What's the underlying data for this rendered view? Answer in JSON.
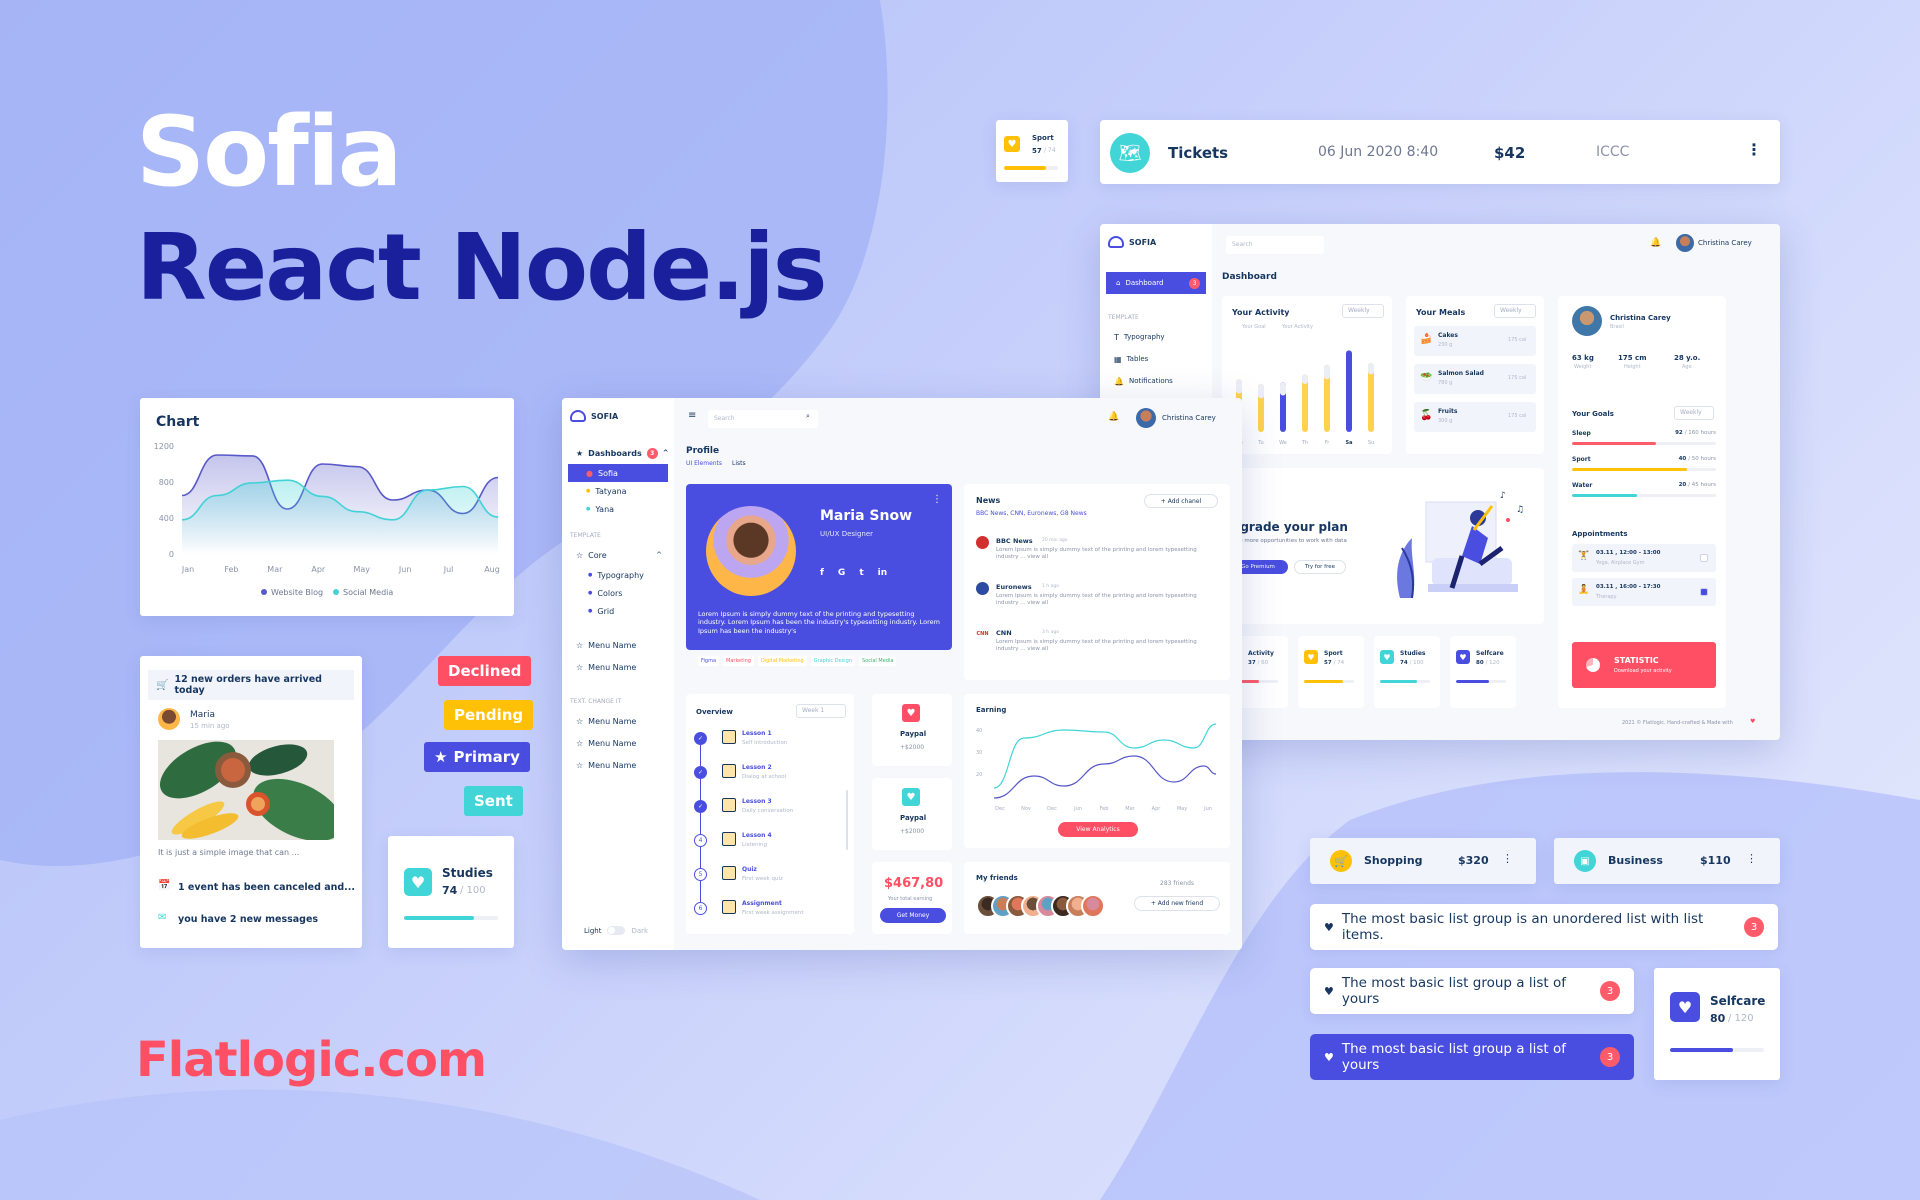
{
  "hero": {
    "line1": "Sofia",
    "line2": "React Node.js",
    "footer": "Flatlogic.com"
  },
  "colors": {
    "primary": "#4a4ee0",
    "navy": "#1a1f9b",
    "coral": "#ff4f64",
    "teal": "#41d5d8",
    "yellow": "#ffc107"
  },
  "sport_mini": {
    "label": "Sport",
    "value": "57",
    "total": "/ 74",
    "progress": 0.77
  },
  "tickets": {
    "icon": "map-icon",
    "title": "Tickets",
    "date": "06 Jun 2020 8:40",
    "price": "$42",
    "org": "ICCC"
  },
  "chart": {
    "title": "Chart"
  },
  "chart_data": {
    "type": "area",
    "categories": [
      "Jan",
      "Feb",
      "Mar",
      "Apr",
      "May",
      "Jun",
      "Jul",
      "Aug"
    ],
    "ylim": [
      0,
      1200
    ],
    "yticks": [
      "0",
      "400",
      "800",
      "1200"
    ],
    "series": [
      {
        "name": "Website Blog",
        "color": "#5758c9",
        "values": [
          650,
          1100,
          1090,
          500,
          1000,
          970,
          600,
          710,
          450,
          850
        ]
      },
      {
        "name": "Social Media",
        "color": "#42d2d6",
        "values": [
          380,
          650,
          790,
          820,
          640,
          470,
          380,
          710,
          750,
          410
        ]
      }
    ]
  },
  "notifications": {
    "items": [
      {
        "icon": "cart-icon",
        "text": "12 new orders have arrived today"
      },
      {
        "icon": "calendar-icon",
        "text": "1 event has been canceled and..."
      },
      {
        "icon": "envelope-icon",
        "text": "you have 2 new messages"
      }
    ],
    "post": {
      "name": "Maria",
      "time": "15 min ago",
      "caption": "It is just a simple image that can ..."
    }
  },
  "badges": {
    "declined": "Declined",
    "pending": "Pending",
    "primary": "Primary",
    "sent": "Sent"
  },
  "studies_card": {
    "label": "Studies",
    "value": "74",
    "total": "/ 100",
    "progress": 0.74
  },
  "selfcare_card": {
    "label": "Selfcare",
    "value": "80",
    "total": "/ 120",
    "progress": 0.67
  },
  "shopping": {
    "label": "Shopping",
    "amount": "$320"
  },
  "business": {
    "label": "Business",
    "amount": "$110"
  },
  "list_group": [
    "The most basic list group is an unordered list with list items.",
    "The most basic list group a list of yours",
    "The most basic list group a list of yours"
  ],
  "list_badge": "3",
  "profile_win": {
    "brand": "SOFIA",
    "search": "Search",
    "user": "Christina Carey",
    "nav": {
      "dashboards": "Dashboards",
      "dash_badge": "3",
      "sub": [
        "Sofia",
        "Tatyana",
        "Yana"
      ],
      "template_cap": "TEMPLATE",
      "core": "Core",
      "core_sub": [
        "Typography",
        "Colors",
        "Grid"
      ],
      "menu": [
        "Menu Name",
        "Menu Name"
      ],
      "textcap": "TEXT. CHANGE IT",
      "menu2": [
        "Menu Name",
        "Menu Name",
        "Menu Name"
      ],
      "light": "Light",
      "dark": "Dark"
    },
    "page": {
      "title": "Profile",
      "crumb1": "UI Elements",
      "crumb2": "Lists"
    },
    "profile": {
      "name": "Maria Snow",
      "role": "UI/UX Designer",
      "bio": "Lorem Ipsum is simply dummy text of the printing and typesetting industry. Lorem Ipsum has been the industry's typesetting industry. Lorem Ipsum has been the industry's",
      "tags": [
        "Figma",
        "Marketing",
        "Digital Marketing",
        "Graphic Design",
        "Social Media"
      ]
    },
    "news": {
      "title": "News",
      "sources": "BBC News, CNN, Euronews, G8 News",
      "add": "+ Add chanel",
      "items": [
        {
          "name": "BBC News",
          "time": "20 min ago",
          "text": "Lorem Ipsum is simply dummy text of the printing and lorem typesetting industry ... view all"
        },
        {
          "name": "Euronews",
          "time": "1 h ago",
          "text": "Lorem Ipsum is simply dummy text of the printing and lorem typesetting industry ... view all"
        },
        {
          "name": "CNN",
          "time": "3 h ago",
          "text": "Lorem Ipsum is simply dummy text of the printing and lorem typesetting industry ... view all"
        }
      ]
    },
    "overview": {
      "title": "Overview",
      "select": "Week 1",
      "lessons": [
        {
          "t": "Lesson 1",
          "s": "Self introduction"
        },
        {
          "t": "Lesson 2",
          "s": "Dialog at school"
        },
        {
          "t": "Lesson 3",
          "s": "Daily conversation"
        },
        {
          "t": "Lesson 4",
          "s": "Listening"
        },
        {
          "t": "Quiz",
          "s": "First week quiz"
        },
        {
          "t": "Assignment",
          "s": "First week assignment"
        }
      ]
    },
    "paypal": [
      {
        "label": "Paypal",
        "amount": "+$2000"
      },
      {
        "label": "Paypal",
        "amount": "+$2000"
      }
    ],
    "earning": {
      "title": "Earning",
      "yticks": [
        "40",
        "30",
        "20"
      ],
      "months": [
        "Dec",
        "Nov",
        "Dec",
        "Jun",
        "Feb",
        "Mar",
        "Apr",
        "May",
        "Jun"
      ],
      "button": "View Analytics"
    },
    "total": {
      "amount": "$467,80",
      "label": "Your total earning",
      "button": "Get Money"
    },
    "friends": {
      "title": "My friends",
      "count": "283 friends",
      "add": "+ Add new friend"
    }
  },
  "dash_win": {
    "brand": "SOFIA",
    "search": "Search",
    "user": "Christina Carey",
    "title": "Dashboard",
    "nav": {
      "dashboard": "Dashboard",
      "badge": "3",
      "cap": "TEMPLATE",
      "items": [
        "Typography",
        "Tables",
        "Notifications"
      ]
    },
    "activity": {
      "title": "Your Activity",
      "select": "Weekly",
      "legend": [
        "Your Goal",
        "Your Activity"
      ],
      "days": [
        "Mo",
        "Tu",
        "We",
        "Th",
        "Fr",
        "Sa",
        "Su"
      ]
    },
    "activity_data": {
      "goal": [
        0.55,
        0.5,
        0.52,
        0.6,
        0.7,
        0.85,
        0.72
      ],
      "activity": [
        0.4,
        0.35,
        0.38,
        0.5,
        0.55,
        0.9,
        0.6
      ]
    },
    "meals": {
      "title": "Your Meals",
      "select": "Weekly",
      "items": [
        {
          "n": "Cakes",
          "w": "230 g",
          "c": "175 cal"
        },
        {
          "n": "Salmon Salad",
          "w": "780 g",
          "c": "175 cal"
        },
        {
          "n": "Fruits",
          "w": "300 g",
          "c": "175 cal"
        }
      ]
    },
    "person": {
      "name": "Christina Carey",
      "city": "Brasil",
      "weight": "63 kg",
      "weight_l": "Weight",
      "height": "175 cm",
      "height_l": "Height",
      "age": "28 y.o.",
      "age_l": "Age"
    },
    "goals": {
      "title": "Your Goals",
      "select": "Weekly",
      "items": [
        {
          "n": "Sleep",
          "v": "92",
          "t": "/ 160 hours",
          "p": 0.58,
          "c": "#ff5b6a"
        },
        {
          "n": "Sport",
          "v": "40",
          "t": "/ 50 hours",
          "p": 0.8,
          "c": "#ffc107"
        },
        {
          "n": "Water",
          "v": "20",
          "t": "/ 45 hours",
          "p": 0.45,
          "c": "#41d5d8"
        }
      ]
    },
    "appointments": {
      "title": "Appointments",
      "items": [
        {
          "d": "03.11 , 12:00 - 13:00",
          "p": "Yoga, Airplace Gym"
        },
        {
          "d": "03.11 , 16:00 - 17:30",
          "p": "Therapy"
        }
      ]
    },
    "upgrade": {
      "title": "Upgrade your plan",
      "text": "Explore more opportunities to work with data",
      "b1": "Go Premium",
      "b2": "Try for free"
    },
    "stats": [
      {
        "n": "Activity",
        "v": "37",
        "t": "/ 60",
        "c": "#ff5b6a"
      },
      {
        "n": "Sport",
        "v": "57",
        "t": "/ 74",
        "c": "#ffc107"
      },
      {
        "n": "Studies",
        "v": "74",
        "t": "/ 100",
        "c": "#41d5d8"
      },
      {
        "n": "Selfcare",
        "v": "80",
        "t": "/ 120",
        "c": "#4a4ee0"
      }
    ],
    "statistic": {
      "title": "STATISTIC",
      "sub": "Download your activity"
    },
    "footer": "2021 © Flatlogic. Hand-crafted & Made with"
  }
}
